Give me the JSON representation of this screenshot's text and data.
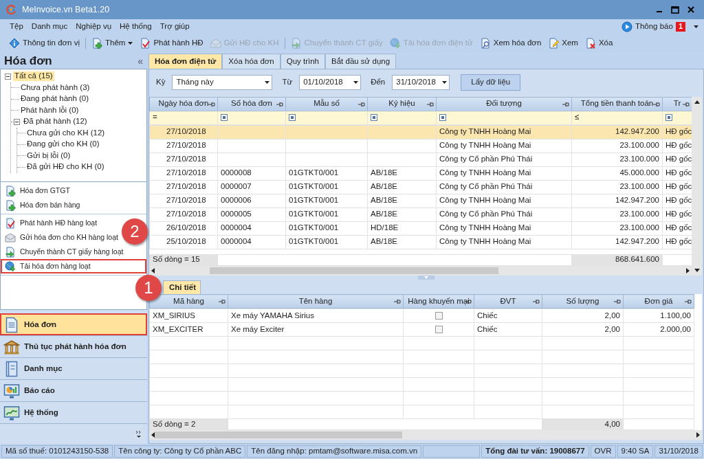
{
  "window": {
    "title": "MeInvoice.vn Beta1.20"
  },
  "menu": [
    "Tệp",
    "Danh mục",
    "Nghiệp vụ",
    "Hệ thống",
    "Trợ giúp"
  ],
  "notification": {
    "label": "Thông báo",
    "count": "1"
  },
  "toolbar": [
    {
      "kind": "button",
      "label": "Thông tin đơn vị",
      "disabled": false
    },
    {
      "kind": "separator"
    },
    {
      "kind": "dropdown",
      "label": "Thêm",
      "disabled": false
    },
    {
      "kind": "button",
      "label": "Phát hành HĐ",
      "disabled": false
    },
    {
      "kind": "button",
      "label": "Gửi HĐ cho KH",
      "disabled": true
    },
    {
      "kind": "separator"
    },
    {
      "kind": "button",
      "label": "Chuyển thành CT giấy",
      "disabled": true
    },
    {
      "kind": "button",
      "label": "Tải hóa đơn điện tử",
      "disabled": true
    },
    {
      "kind": "button",
      "label": "Xem hóa đơn",
      "disabled": false
    },
    {
      "kind": "button",
      "label": "Xem",
      "disabled": false
    },
    {
      "kind": "button",
      "label": "Xóa",
      "disabled": false
    }
  ],
  "sidebar": {
    "title": "Hóa đơn",
    "collapse": "«",
    "tree": [
      {
        "label": "Tất cả (15)",
        "selected": true,
        "expanded": true,
        "children": [
          {
            "label": "Chưa phát hành (3)",
            "selected": false
          },
          {
            "label": "Đang phát hành (0)",
            "selected": false
          },
          {
            "label": "Phát hành lỗi (0)",
            "selected": false
          },
          {
            "label": "Đã phát hành (12)",
            "selected": false,
            "expanded": true,
            "children": [
              {
                "label": "Chưa gửi cho KH (12)",
                "selected": false
              },
              {
                "label": "Đang gửi cho KH (0)",
                "selected": false
              },
              {
                "label": "Gửi bị lỗi (0)",
                "selected": false
              },
              {
                "label": "Đã gửi HĐ cho KH (0)",
                "selected": false
              }
            ]
          }
        ]
      }
    ],
    "action_groups": [
      [
        {
          "label": "Hóa đơn GTGT",
          "highlighted": false
        },
        {
          "label": "Hóa đơn bán hàng",
          "highlighted": false
        }
      ],
      [
        {
          "label": "Phát hành HĐ hàng loạt",
          "highlighted": false
        },
        {
          "label": "Gửi hóa đơn cho KH hàng loạt",
          "highlighted": false,
          "marker": "2"
        },
        {
          "label": "Chuyển thành CT giấy hàng loạt",
          "highlighted": false
        },
        {
          "label": "Tải hóa đơn hàng loạt",
          "highlighted": true
        }
      ]
    ],
    "nav": [
      {
        "label": "Hóa đơn",
        "selected": true,
        "highlighted": true
      },
      {
        "label": "Thủ tục phát hành hóa đơn",
        "selected": false,
        "highlighted": false
      },
      {
        "label": "Danh mục",
        "selected": false,
        "highlighted": false
      },
      {
        "label": "Báo cáo",
        "selected": false,
        "highlighted": false
      },
      {
        "label": "Hệ thống",
        "selected": false,
        "highlighted": false
      }
    ]
  },
  "tabs": [
    {
      "label": "Hóa đơn điện tử",
      "selected": true
    },
    {
      "label": "Xóa hóa đơn",
      "selected": false
    },
    {
      "label": "Quy trình",
      "selected": false
    },
    {
      "label": "Bắt đầu sử dụng",
      "selected": false
    }
  ],
  "filter": {
    "period": {
      "label": "Kỳ",
      "value": "Tháng này"
    },
    "from": {
      "label": "Từ",
      "value": "01/10/2018"
    },
    "to": {
      "label": "Đến",
      "value": "31/10/2018"
    },
    "button": "Lấy dữ liệu"
  },
  "invoices": {
    "columns": [
      {
        "label": "Ngày hóa đơn",
        "filter_operator": "="
      },
      {
        "label": "Số hóa đơn"
      },
      {
        "label": "Mẫu số"
      },
      {
        "label": "Ký hiệu"
      },
      {
        "label": "Đối tượng"
      },
      {
        "label": "Tổng tiền thanh toán",
        "filter_operator": "≤"
      },
      {
        "label": "Tr"
      }
    ],
    "rows": [
      {
        "selected": true,
        "cells": [
          "27/10/2018",
          null,
          null,
          null,
          "Công ty TNHH Hoàng Mai",
          "142.947.200",
          "HĐ gốc"
        ]
      },
      {
        "selected": false,
        "cells": [
          "27/10/2018",
          null,
          null,
          null,
          "Công ty TNHH Hoàng Mai",
          "23.100.000",
          "HĐ gốc"
        ]
      },
      {
        "selected": false,
        "cells": [
          "27/10/2018",
          null,
          null,
          null,
          "Công ty Cổ phần Phú Thái",
          "23.100.000",
          "HĐ gốc"
        ]
      },
      {
        "selected": false,
        "cells": [
          "27/10/2018",
          "0000008",
          "01GTKT0/001",
          "AB/18E",
          "Công ty TNHH Hoàng Mai",
          "45.000.000",
          "HĐ gốc"
        ]
      },
      {
        "selected": false,
        "cells": [
          "27/10/2018",
          "0000007",
          "01GTKT0/001",
          "AB/18E",
          "Công ty Cổ phần Phú Thái",
          "23.100.000",
          "HĐ gốc"
        ]
      },
      {
        "selected": false,
        "cells": [
          "27/10/2018",
          "0000006",
          "01GTKT0/001",
          "AB/18E",
          "Công ty TNHH Hoàng Mai",
          "142.947.200",
          "HĐ gốc"
        ]
      },
      {
        "selected": false,
        "cells": [
          "27/10/2018",
          "0000005",
          "01GTKT0/001",
          "AB/18E",
          "Công ty Cổ phần Phú Thái",
          "23.100.000",
          "HĐ gốc"
        ]
      },
      {
        "selected": false,
        "cells": [
          "26/10/2018",
          "0000004",
          "01GTKT0/001",
          "HD/18E",
          "Công ty TNHH Hoàng Mai",
          "23.100.000",
          "HĐ gốc"
        ]
      },
      {
        "selected": false,
        "cells": [
          "25/10/2018",
          "0000004",
          "01GTKT0/001",
          "AB/18E",
          "Công ty TNHH Hoàng Mai",
          "142.947.200",
          "HĐ gốc"
        ]
      }
    ],
    "footer": {
      "count": "Số dòng = 15",
      "total": "868.641.600"
    }
  },
  "detail": {
    "tab": {
      "label": "Chi tiết",
      "selected": true,
      "marker": "1"
    },
    "columns": [
      "Mã hàng",
      "Tên hàng",
      "Hàng khuyến mại",
      "ĐVT",
      "Số lượng",
      "Đơn giá"
    ],
    "rows": [
      {
        "code": "XM_SIRIUS",
        "name": "Xe máy YAMAHA Sirius",
        "promo": false,
        "unit": "Chiếc",
        "qty": "2,00",
        "price": "1.100,00"
      },
      {
        "code": "XM_EXCITER",
        "name": "Xe máy Exciter",
        "promo": false,
        "unit": "Chiếc",
        "qty": "2,00",
        "price": "2.000,00"
      }
    ],
    "footer": {
      "count": "Số dòng = 2",
      "qty_total": "4,00"
    }
  },
  "status_bar": [
    {
      "kind": "text",
      "text": "Mã số thuế: 0101243150-538",
      "bold": false
    },
    {
      "kind": "text",
      "text": "Tên công ty: Công ty Cổ phần ABC",
      "bold": false
    },
    {
      "kind": "text",
      "text": "Tên đăng nhập: pmtam@software.misa.com.vn",
      "bold": false
    },
    {
      "kind": "spacer"
    },
    {
      "kind": "text",
      "text": "Tổng đài tư vấn: 19008677",
      "bold": true
    },
    {
      "kind": "text",
      "text": "OVR",
      "bold": false
    },
    {
      "kind": "text",
      "text": "9:40 SA",
      "bold": false
    },
    {
      "kind": "text",
      "text": "31/10/2018",
      "bold": false
    }
  ]
}
